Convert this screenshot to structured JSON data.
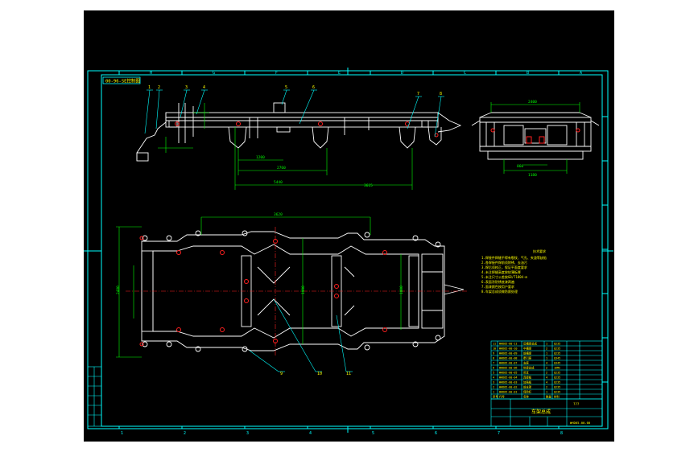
{
  "sheet": {
    "title_tag": "00-96-SE控制图",
    "border_letters": [
      "A",
      "B",
      "C",
      "D",
      "E",
      "F",
      "G",
      "H"
    ],
    "border_numbers": [
      "1",
      "2",
      "3",
      "4",
      "5",
      "6",
      "7",
      "8"
    ],
    "colors": {
      "background": "#000000",
      "frame": "#00ffff",
      "part_outline": "#ffffff",
      "dimension": "#00ff00",
      "center_line": "#ff0000",
      "highlight": "#ff00ff",
      "text": "#ffff00",
      "callout": "#00ffff"
    }
  },
  "side_view": {
    "callouts": [
      "1",
      "2",
      "3",
      "4",
      "5",
      "6",
      "7",
      "8"
    ],
    "dims": [
      "1200",
      "2760",
      "5440",
      "3615"
    ]
  },
  "end_view": {
    "dims": [
      "2400",
      "1180",
      "860"
    ]
  },
  "plan_view": {
    "callouts": [
      "9",
      "10",
      "11"
    ],
    "dims": [
      "3620",
      "2480",
      "1990",
      "1800"
    ]
  },
  "tech_notes": {
    "heading": "技术要求",
    "lines": [
      "1.焊接件焊缝不得有裂纹、气孔、夹渣等缺陷",
      "2.各焊接件焊前须除锈、去油污",
      "3.焊后须校正，保证平面度要求",
      "4.未注焊缝高度按较薄板厚",
      "5.未注尺寸公差按GB/T1804-m",
      "6.表面涂防锈底漆两遍",
      "7.面漆颜色按用户要求",
      "8.车架总成须做防腐处理"
    ]
  },
  "parts_list": {
    "rows": [
      {
        "no": "11",
        "code": "WHD05-00-11",
        "name": "后横梁总成",
        "qty": "1",
        "material": "Q235"
      },
      {
        "no": "10",
        "code": "WHD05-00-10",
        "name": "中横梁",
        "qty": "2",
        "material": "Q235"
      },
      {
        "no": "9",
        "code": "WHD05-00-09",
        "name": "前横梁",
        "qty": "1",
        "material": "Q235"
      },
      {
        "no": "8",
        "code": "WHD05-00-08",
        "name": "牵引座",
        "qty": "1",
        "material": "Q345"
      },
      {
        "no": "7",
        "code": "WHD05-00-07",
        "name": "支座",
        "qty": "4",
        "material": "Q345"
      },
      {
        "no": "6",
        "code": "WHD05-00-06",
        "name": "纵梁总成",
        "qty": "2",
        "material": "16Mn"
      },
      {
        "no": "5",
        "code": "WHD05-00-05",
        "name": "吊耳",
        "qty": "2",
        "material": "Q235"
      },
      {
        "no": "4",
        "code": "WHD05-00-04",
        "name": "连接板",
        "qty": "4",
        "material": "Q235"
      },
      {
        "no": "3",
        "code": "WHD05-00-03",
        "name": "加强板",
        "qty": "4",
        "material": "Q235"
      },
      {
        "no": "2",
        "code": "WHD05-00-02",
        "name": "前支架",
        "qty": "2",
        "material": "Q235"
      },
      {
        "no": "1",
        "code": "WHD05-00-01",
        "name": "保险杠",
        "qty": "1",
        "material": "Q235"
      }
    ],
    "header": {
      "no": "序号",
      "code": "代号",
      "name": "名称",
      "qty": "数量",
      "material": "材料"
    }
  },
  "title_block": {
    "drawing_name": "车架总成",
    "company": "???",
    "drawing_number": "WHD05-00-00"
  },
  "revision_block": {
    "rows": [
      "",
      "",
      "",
      "",
      "",
      ""
    ]
  }
}
